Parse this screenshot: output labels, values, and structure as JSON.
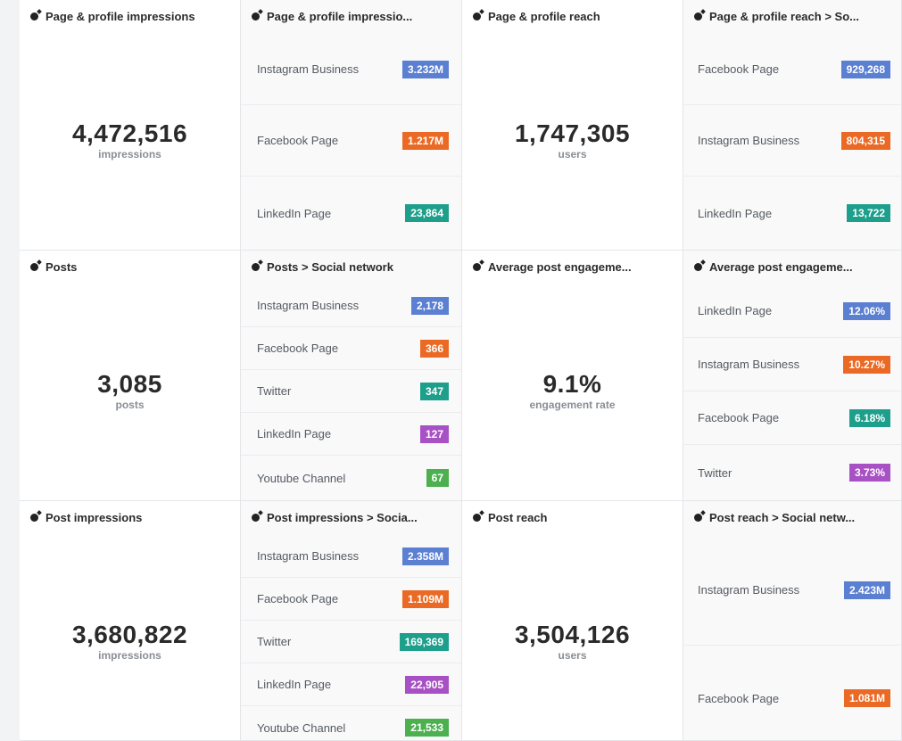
{
  "colors": {
    "instagram": "#5b7fd1",
    "facebook": "#ea6a25",
    "linkedin_teal": "#1d9f8c",
    "twitter_teal": "#1d9f8c",
    "linkedin_purple": "#a851c5",
    "youtube": "#4caf50"
  },
  "cards": {
    "c11": {
      "title": "Page & profile impressions",
      "value": "4,472,516",
      "unit": "impressions"
    },
    "c12": {
      "title": "Page & profile impressio...",
      "rows": [
        {
          "label": "Instagram Business",
          "value": "3.232M"
        },
        {
          "label": "Facebook Page",
          "value": "1.217M"
        },
        {
          "label": "LinkedIn Page",
          "value": "23,864"
        }
      ]
    },
    "c13": {
      "title": "Page & profile reach",
      "value": "1,747,305",
      "unit": "users"
    },
    "c14": {
      "title": "Page & profile reach > So...",
      "rows": [
        {
          "label": "Facebook Page",
          "value": "929,268"
        },
        {
          "label": "Instagram Business",
          "value": "804,315"
        },
        {
          "label": "LinkedIn Page",
          "value": "13,722"
        }
      ]
    },
    "c21": {
      "title": "Posts",
      "value": "3,085",
      "unit": "posts"
    },
    "c22": {
      "title": "Posts > Social network",
      "rows": [
        {
          "label": "Instagram Business",
          "value": "2,178"
        },
        {
          "label": "Facebook Page",
          "value": "366"
        },
        {
          "label": "Twitter",
          "value": "347"
        },
        {
          "label": "LinkedIn Page",
          "value": "127"
        },
        {
          "label": "Youtube Channel",
          "value": "67"
        }
      ]
    },
    "c23": {
      "title": "Average post engageme...",
      "value": "9.1%",
      "unit": "engagement rate"
    },
    "c24": {
      "title": "Average post engageme...",
      "rows": [
        {
          "label": "LinkedIn Page",
          "value": "12.06%"
        },
        {
          "label": "Instagram Business",
          "value": "10.27%"
        },
        {
          "label": "Facebook Page",
          "value": "6.18%"
        },
        {
          "label": "Twitter",
          "value": "3.73%"
        }
      ]
    },
    "c31": {
      "title": "Post impressions",
      "value": "3,680,822",
      "unit": "impressions"
    },
    "c32": {
      "title": "Post impressions > Socia...",
      "rows": [
        {
          "label": "Instagram Business",
          "value": "2.358M"
        },
        {
          "label": "Facebook Page",
          "value": "1.109M"
        },
        {
          "label": "Twitter",
          "value": "169,369"
        },
        {
          "label": "LinkedIn Page",
          "value": "22,905"
        },
        {
          "label": "Youtube Channel",
          "value": "21,533"
        }
      ]
    },
    "c33": {
      "title": "Post reach",
      "value": "3,504,126",
      "unit": "users"
    },
    "c34": {
      "title": "Post reach > Social netw...",
      "rows": [
        {
          "label": "Instagram Business",
          "value": "2.423M"
        },
        {
          "label": "Facebook Page",
          "value": "1.081M"
        }
      ]
    }
  }
}
